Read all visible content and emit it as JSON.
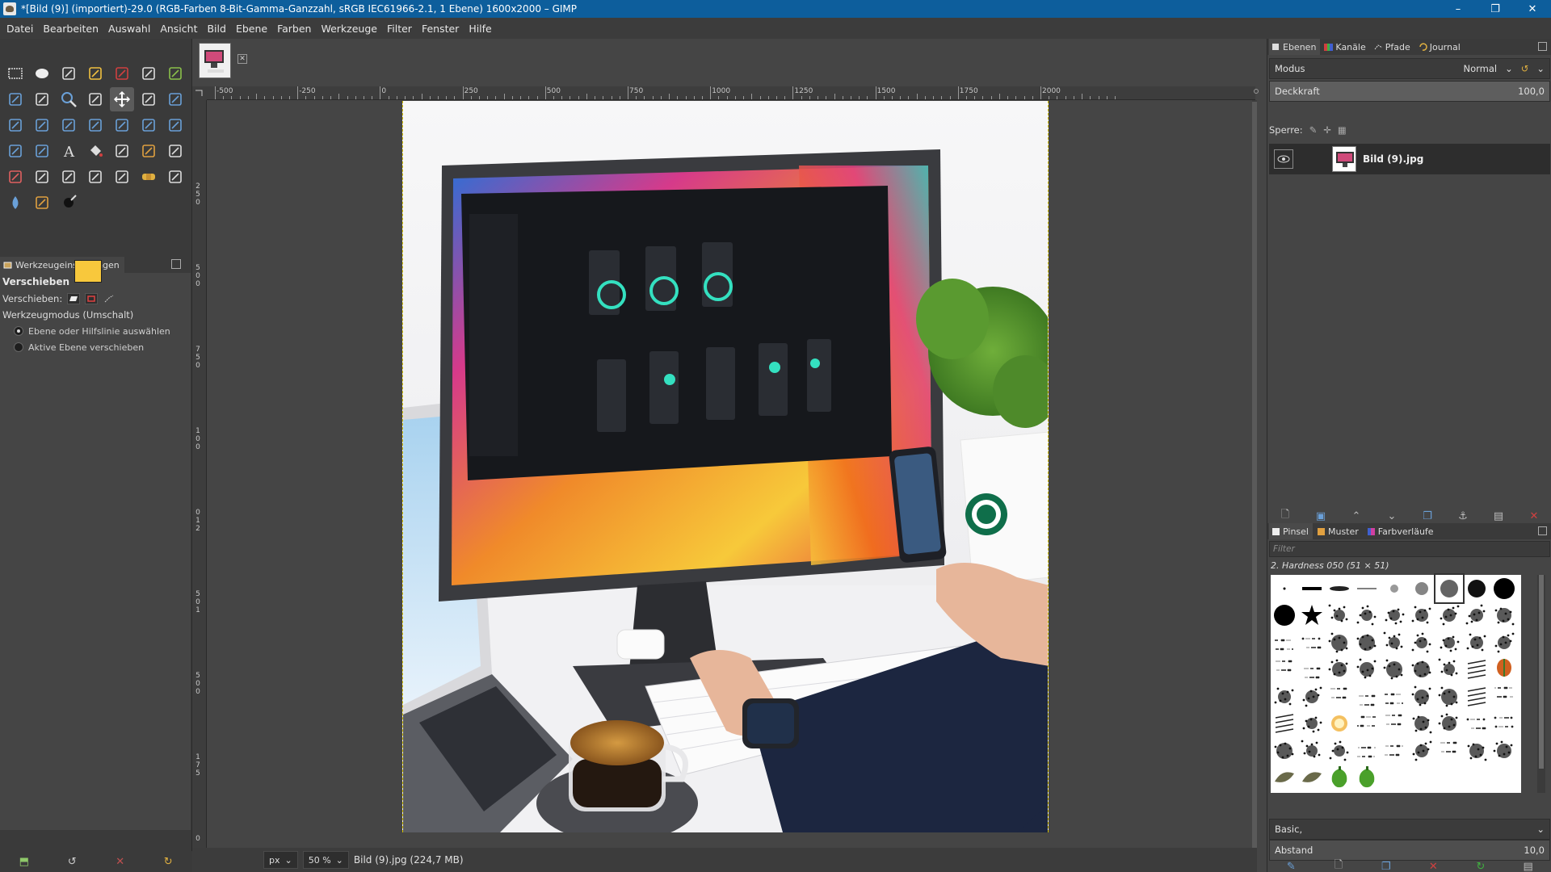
{
  "window": {
    "title": "*[Bild (9)] (importiert)-29.0 (RGB-Farben 8-Bit-Gamma-Ganzzahl, sRGB IEC61966-2.1, 1 Ebene) 1600x2000 – GIMP",
    "minimize": "–",
    "maximize": "❐",
    "close": "✕"
  },
  "menu": [
    "Datei",
    "Bearbeiten",
    "Auswahl",
    "Ansicht",
    "Bild",
    "Ebene",
    "Farben",
    "Werkzeuge",
    "Filter",
    "Fenster",
    "Hilfe"
  ],
  "tools": [
    "rect-select",
    "ellipse-select",
    "free-select",
    "fuzzy-select",
    "select-by-color",
    "scissors-select",
    "foreground-select",
    "paths",
    "color-picker",
    "zoom",
    "measure",
    "move",
    "align",
    "crop",
    "unified-transform",
    "rotate",
    "scale",
    "shear",
    "flip",
    "perspective",
    "cage-transform",
    "warp-transform",
    "handle-transform",
    "text",
    "bucket-fill",
    "gradient",
    "pencil",
    "paintbrush",
    "eraser",
    "airbrush",
    "ink",
    "mypaint-brush",
    "clone",
    "heal",
    "perspective-clone",
    "blur-sharpen",
    "smudge",
    "dodge-burn"
  ],
  "colors": {
    "foreground": "#f8c83c",
    "background": "#ffffff"
  },
  "tool_options": {
    "tab_label": "Werkzeugeinstellungen",
    "heading": "Verschieben",
    "move_label": "Verschieben:",
    "mode_label": "Werkzeugmodus (Umschalt)",
    "radio1": "Ebene oder Hilfslinie auswählen",
    "radio2": "Aktive Ebene verschieben"
  },
  "ruler": {
    "h": [
      "-500",
      "-250",
      "0",
      "250",
      "500",
      "750",
      "1000",
      "1250",
      "1500",
      "1750",
      "2000"
    ],
    "v": [
      "2",
      "5",
      "0",
      "5",
      "0",
      "0",
      "7",
      "5",
      "0",
      "1",
      "0",
      "0",
      "0",
      "1",
      "2",
      "5",
      "0",
      "1",
      "5",
      "0",
      "0",
      "1",
      "7",
      "5",
      "0"
    ]
  },
  "status": {
    "unit": "px",
    "zoom": "50 %",
    "info": "Bild (9).jpg (224,7 MB)"
  },
  "right_dock": {
    "tabs": [
      "Ebenen",
      "Kanäle",
      "Pfade",
      "Journal"
    ],
    "mode_label": "Modus",
    "mode_value": "Normal",
    "opacity_label": "Deckkraft",
    "opacity_value": "100,0",
    "lock_label": "Sperre:",
    "layer_name": "Bild (9).jpg",
    "brush_tabs": [
      "Pinsel",
      "Muster",
      "Farbverläufe"
    ],
    "filter_placeholder": "Filter",
    "brush_name": "2. Hardness 050 (51 × 51)",
    "brush_preset": "Basic,",
    "spacing_label": "Abstand",
    "spacing_value": "10,0"
  }
}
